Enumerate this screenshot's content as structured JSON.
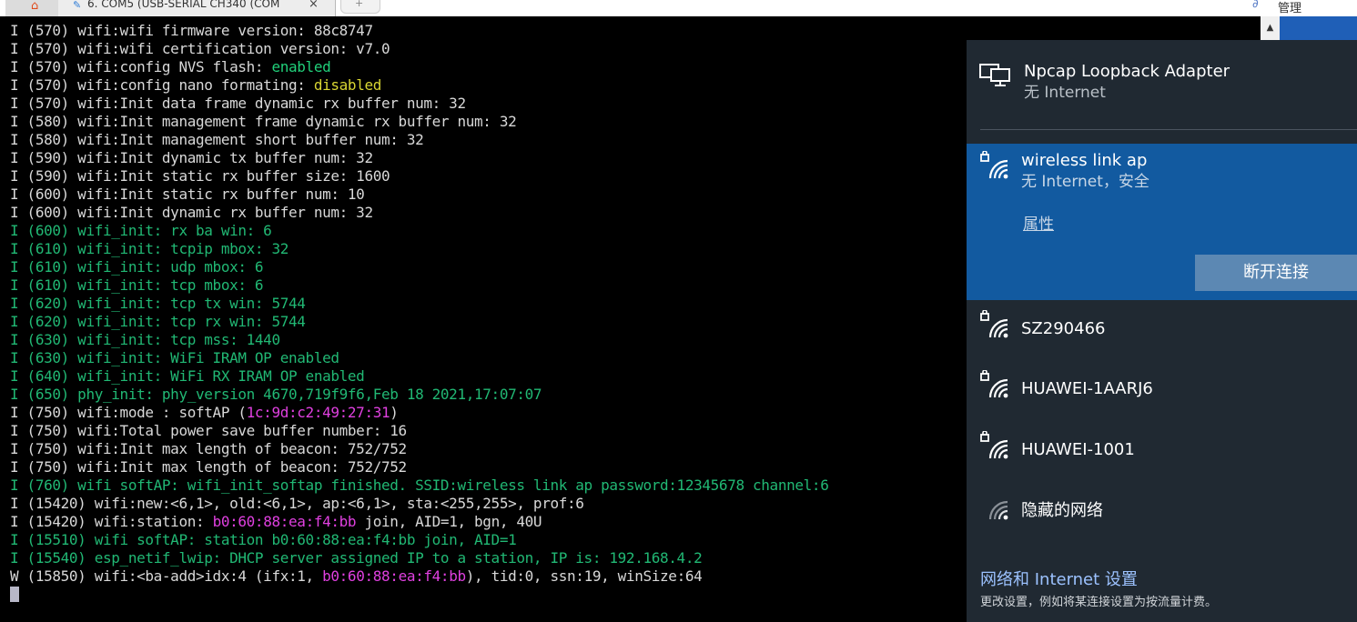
{
  "tab_bar": {
    "session_tab_title": "6. COM5  (USB-SERIAL CH340 (COM",
    "close_glyph": "×",
    "new_tab_glyph": "+",
    "manage_label": "管理"
  },
  "terminal": {
    "lines": [
      {
        "color": "default",
        "segments": [
          {
            "text": "I (570) wifi:wifi firmware version: 88c8747",
            "color": "default"
          }
        ]
      },
      {
        "color": "default",
        "segments": [
          {
            "text": "I (570) wifi:wifi certification version: v7.0",
            "color": "default"
          }
        ]
      },
      {
        "color": "default",
        "segments": [
          {
            "text": "I (570) wifi:config NVS flash: ",
            "color": "default"
          },
          {
            "text": "enabled",
            "color": "green"
          }
        ]
      },
      {
        "color": "default",
        "segments": [
          {
            "text": "I (570) wifi:config nano formating: ",
            "color": "default"
          },
          {
            "text": "disabled",
            "color": "yellow"
          }
        ]
      },
      {
        "color": "default",
        "segments": [
          {
            "text": "I (570) wifi:Init data frame dynamic rx buffer num: 32",
            "color": "default"
          }
        ]
      },
      {
        "color": "default",
        "segments": [
          {
            "text": "I (580) wifi:Init management frame dynamic rx buffer num: 32",
            "color": "default"
          }
        ]
      },
      {
        "color": "default",
        "segments": [
          {
            "text": "I (580) wifi:Init management short buffer num: 32",
            "color": "default"
          }
        ]
      },
      {
        "color": "default",
        "segments": [
          {
            "text": "I (590) wifi:Init dynamic tx buffer num: 32",
            "color": "default"
          }
        ]
      },
      {
        "color": "default",
        "segments": [
          {
            "text": "I (590) wifi:Init static rx buffer size: 1600",
            "color": "default"
          }
        ]
      },
      {
        "color": "default",
        "segments": [
          {
            "text": "I (600) wifi:Init static rx buffer num: 10",
            "color": "default"
          }
        ]
      },
      {
        "color": "default",
        "segments": [
          {
            "text": "I (600) wifi:Init dynamic rx buffer num: 32",
            "color": "default"
          }
        ]
      },
      {
        "color": "green",
        "segments": [
          {
            "text": "I (600) wifi_init: rx ba win: 6",
            "color": "green"
          }
        ]
      },
      {
        "color": "green",
        "segments": [
          {
            "text": "I (610) wifi_init: tcpip mbox: 32",
            "color": "green"
          }
        ]
      },
      {
        "color": "green",
        "segments": [
          {
            "text": "I (610) wifi_init: udp mbox: 6",
            "color": "green"
          }
        ]
      },
      {
        "color": "green",
        "segments": [
          {
            "text": "I (610) wifi_init: tcp mbox: 6",
            "color": "green"
          }
        ]
      },
      {
        "color": "green",
        "segments": [
          {
            "text": "I (620) wifi_init: tcp tx win: 5744",
            "color": "green"
          }
        ]
      },
      {
        "color": "green",
        "segments": [
          {
            "text": "I (620) wifi_init: tcp rx win: 5744",
            "color": "green"
          }
        ]
      },
      {
        "color": "green",
        "segments": [
          {
            "text": "I (630) wifi_init: tcp mss: 1440",
            "color": "green"
          }
        ]
      },
      {
        "color": "green",
        "segments": [
          {
            "text": "I (630) wifi_init: WiFi IRAM OP enabled",
            "color": "green"
          }
        ]
      },
      {
        "color": "green",
        "segments": [
          {
            "text": "I (640) wifi_init: WiFi RX IRAM OP enabled",
            "color": "green"
          }
        ]
      },
      {
        "color": "green",
        "segments": [
          {
            "text": "I (650) phy_init: phy_version 4670,719f9f6,Feb 18 2021,17:07:07",
            "color": "green"
          }
        ]
      },
      {
        "color": "default",
        "segments": [
          {
            "text": "I (750) wifi:mode : softAP (",
            "color": "default"
          },
          {
            "text": "1c:9d:c2:49:27:31",
            "color": "magenta"
          },
          {
            "text": ")",
            "color": "default"
          }
        ]
      },
      {
        "color": "default",
        "segments": [
          {
            "text": "I (750) wifi:Total power save buffer number: 16",
            "color": "default"
          }
        ]
      },
      {
        "color": "default",
        "segments": [
          {
            "text": "I (750) wifi:Init max length of beacon: 752/752",
            "color": "default"
          }
        ]
      },
      {
        "color": "default",
        "segments": [
          {
            "text": "I (750) wifi:Init max length of beacon: 752/752",
            "color": "default"
          }
        ]
      },
      {
        "color": "green",
        "segments": [
          {
            "text": "I (760) wifi softAP: wifi_init_softap finished. SSID:wireless link ap password:12345678 channel:6",
            "color": "green"
          }
        ]
      },
      {
        "color": "default",
        "segments": [
          {
            "text": "I (15420) wifi:new:<6,1>, old:<6,1>, ap:<6,1>, sta:<255,255>, prof:6",
            "color": "default"
          }
        ]
      },
      {
        "color": "default",
        "segments": [
          {
            "text": "I (15420) wifi:station: ",
            "color": "default"
          },
          {
            "text": "b0:60:88:ea:f4:bb",
            "color": "magenta"
          },
          {
            "text": " join, AID=1, bgn, 40U",
            "color": "default"
          }
        ]
      },
      {
        "color": "green",
        "segments": [
          {
            "text": "I (15510) wifi softAP: station b0:60:88:ea:f4:bb join, AID=1",
            "color": "green"
          }
        ]
      },
      {
        "color": "green",
        "segments": [
          {
            "text": "I (15540) esp_netif_lwip: DHCP server assigned IP to a station, IP is: 192.168.4.2",
            "color": "green"
          }
        ]
      },
      {
        "color": "default",
        "segments": [
          {
            "text": "W (15850) wifi:<ba-add>idx:4 (ifx:1, ",
            "color": "default"
          },
          {
            "text": "b0:60:88:ea:f4:bb",
            "color": "magenta"
          },
          {
            "text": "), tid:0, ssn:19, winSize:64",
            "color": "default"
          }
        ]
      }
    ]
  },
  "flyout": {
    "ethernet": {
      "name": "Npcap Loopback Adapter",
      "status": "无 Internet",
      "icon": "wired-network-icon"
    },
    "active_network": {
      "name": "wireless link ap",
      "status": "无 Internet，安全",
      "properties_label": "属性",
      "disconnect_label": "断开连接",
      "icon": "secured-wifi-icon"
    },
    "networks": [
      {
        "name": "SZ290466",
        "icon": "secured-wifi-icon"
      },
      {
        "name": "HUAWEI-1AARJ6",
        "icon": "secured-wifi-icon"
      },
      {
        "name": "HUAWEI-1001",
        "icon": "secured-wifi-icon"
      },
      {
        "name": "隐藏的网络",
        "icon": "hidden-wifi-icon"
      }
    ],
    "settings_link": "网络和 Internet 设置",
    "settings_description": "更改设置，例如将某连接设置为按流量计费。"
  },
  "colors": {
    "terminal_bg": "#000000",
    "terminal_text": "#d8d8d8",
    "terminal_green": "#21b874",
    "terminal_magenta": "#e040e0",
    "terminal_yellow": "#d9d633",
    "flyout_bg": "#202932",
    "flyout_active": "#125aa0",
    "disconnect_button": "#5c88b3",
    "link_blue": "#9cc2ff"
  }
}
